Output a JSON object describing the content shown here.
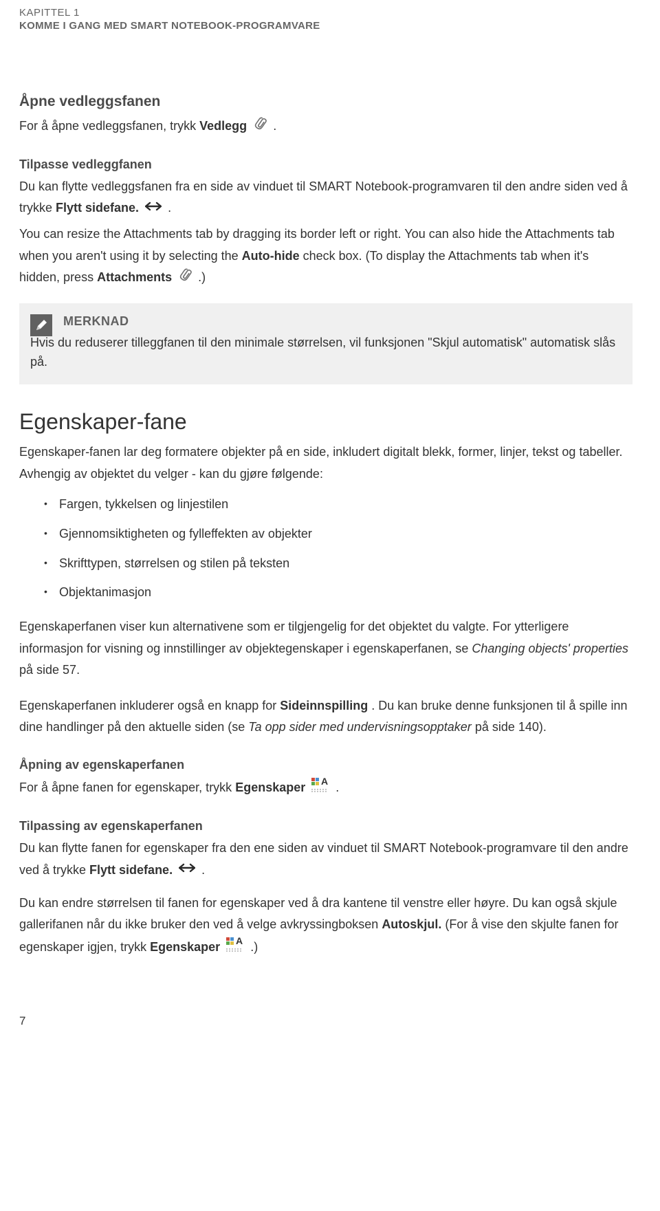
{
  "header": {
    "chapter": "KAPITTEL 1",
    "subtitle": "KOMME I GANG MED SMART NOTEBOOK-PROGRAMVARE"
  },
  "sections": {
    "open_attach": {
      "heading": "Åpne vedleggsfanen",
      "text_pre": "For å åpne vedleggsfanen, trykk ",
      "bold": "Vedlegg",
      "text_post": " ."
    },
    "adjust_attach": {
      "heading": "Tilpasse vedleggfanen",
      "p1_pre": "Du kan flytte vedleggsfanen fra en side av vinduet til SMART Notebook-programvaren til den andre siden ved å trykke ",
      "p1_bold": "Flytt sidefane.",
      "p1_post": " .",
      "p2_pre": "You can resize the Attachments tab by dragging its border left or right. You can also hide the Attachments tab when you aren't using it by selecting the ",
      "p2_bold1": "Auto-hide",
      "p2_mid": " check box. (To display the Attachments tab when it's hidden, press ",
      "p2_bold2": "Attachments",
      "p2_post": " .)"
    },
    "note": {
      "title": "MERKNAD",
      "text": "Hvis du reduserer tilleggfanen til den minimale størrelsen, vil funksjonen \"Skjul automatisk\" automatisk slås på."
    },
    "props": {
      "heading": "Egenskaper-fane",
      "intro": "Egenskaper-fanen lar deg formatere objekter på en side, inkludert digitalt blekk, former, linjer, tekst og tabeller. Avhengig av objektet du velger - kan du gjøre følgende:",
      "bullets": [
        "Fargen, tykkelsen og linjestilen",
        "Gjennomsiktigheten og fylleffekten av objekter",
        "Skrifttypen, størrelsen og stilen på teksten",
        "Objektanimasjon"
      ],
      "p2_pre": "Egenskaperfanen viser kun alternativene som er tilgjengelig for det objektet du valgte. For ytterligere informasjon for visning og innstillinger av objektegenskaper i egenskaperfanen, se ",
      "p2_italic": "Changing objects' properties",
      "p2_post": " på side 57.",
      "p3_pre": "Egenskaperfanen inkluderer også en knapp for ",
      "p3_bold": "Sideinnspilling",
      "p3_mid": " . Du kan bruke denne funksjonen til å spille inn dine handlinger på den aktuelle siden (se ",
      "p3_italic": "Ta opp sider med undervisningsopptaker",
      "p3_post": " på side 140)."
    },
    "open_props": {
      "heading": "Åpning av egenskaperfanen",
      "text_pre": "For å åpne fanen for egenskaper, trykk ",
      "bold": "Egenskaper",
      "text_post": "."
    },
    "adjust_props": {
      "heading": "Tilpassing av egenskaperfanen",
      "p1_pre": "Du kan flytte fanen for egenskaper fra den ene siden av vinduet til SMART Notebook-programvare til den andre ved å trykke ",
      "p1_bold": "Flytt sidefane.",
      "p1_post": " .",
      "p2_pre": "Du kan endre størrelsen til fanen for egenskaper ved å dra kantene til venstre eller høyre. Du kan også skjule gallerifanen når du ikke bruker den ved å velge avkryssingboksen ",
      "p2_bold1": "Autoskjul.",
      "p2_mid": " (For å vise den skjulte fanen for egenskaper igjen, trykk",
      "p2_bold2": "Egenskaper",
      "p2_post": ".)"
    }
  },
  "page_number": "7"
}
